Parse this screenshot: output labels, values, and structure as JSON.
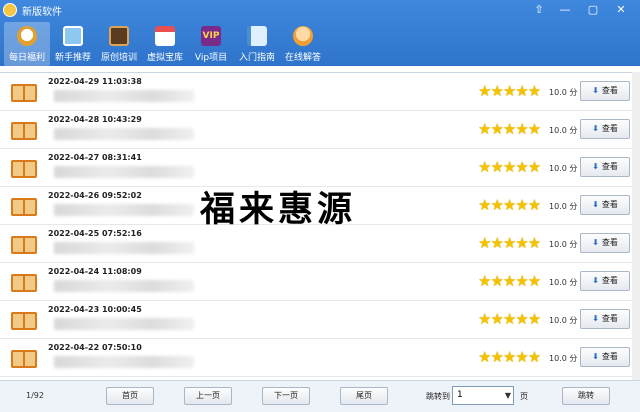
{
  "window": {
    "title": "新版软件"
  },
  "window_controls": [
    "⇧",
    "—",
    "▢",
    "✕"
  ],
  "nav": [
    {
      "label": "每日福利",
      "icon": "lucky-cat-icon",
      "active": true
    },
    {
      "label": "新手推荐",
      "icon": "monitor-icon"
    },
    {
      "label": "原创培训",
      "icon": "blackboard-icon"
    },
    {
      "label": "虚拟宝库",
      "icon": "shop-icon"
    },
    {
      "label": "Vip项目",
      "icon": "vip-icon",
      "badge": "VIP"
    },
    {
      "label": "入门指南",
      "icon": "book-icon"
    },
    {
      "label": "在线解答",
      "icon": "person-icon"
    }
  ],
  "rows": [
    {
      "date": "2022-04-29 11:03:38",
      "stars": "★★★★★",
      "score": "10.0 分",
      "view": "查看"
    },
    {
      "date": "2022-04-28 10:43:29",
      "stars": "★★★★★",
      "score": "10.0 分",
      "view": "查看"
    },
    {
      "date": "2022-04-27 08:31:41",
      "stars": "★★★★★",
      "score": "10.0 分",
      "view": "查看"
    },
    {
      "date": "2022-04-26 09:52:02",
      "stars": "★★★★★",
      "score": "10.0 分",
      "view": "查看"
    },
    {
      "date": "2022-04-25 07:52:16",
      "stars": "★★★★★",
      "score": "10.0 分",
      "view": "查看"
    },
    {
      "date": "2022-04-24 11:08:09",
      "stars": "★★★★★",
      "score": "10.0 分",
      "view": "查看"
    },
    {
      "date": "2022-04-23 10:00:45",
      "stars": "★★★★★",
      "score": "10.0 分",
      "view": "查看"
    },
    {
      "date": "2022-04-22 07:50:10",
      "stars": "★★★★★",
      "score": "10.0 分",
      "view": "查看"
    }
  ],
  "watermark": "福来惠源",
  "footer": {
    "page_info": "1/92",
    "first": "首页",
    "prev": "上一页",
    "next": "下一页",
    "last": "尾页",
    "jump_label": "跳转到",
    "jump_value": "1",
    "page_unit": "页",
    "jump_button": "跳转"
  },
  "colors": {
    "toolbar": "#3a82d8",
    "star": "#f3c300",
    "book": "#d97a1a"
  }
}
